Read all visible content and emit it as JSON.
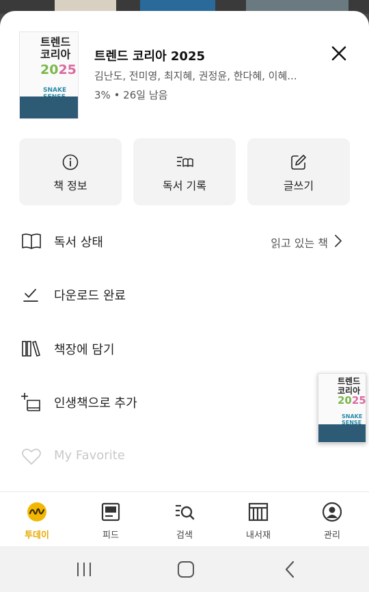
{
  "book": {
    "title": "트렌드 코리아 2025",
    "authors": "김난도, 전미영, 최지혜, 권정윤, 한다혜, 이혜...",
    "progress": "3% • 26일 남음",
    "cover": {
      "title_line1": "트렌드",
      "title_line2": "코리아",
      "year_a": "20",
      "year_b": "25",
      "snake_line1": "SNAKE",
      "snake_line2": "SENSE"
    }
  },
  "actions": [
    {
      "label": "책 정보",
      "icon": "info-icon"
    },
    {
      "label": "독서 기록",
      "icon": "reading-log-icon"
    },
    {
      "label": "글쓰기",
      "icon": "edit-icon"
    }
  ],
  "menu": {
    "reading_status": {
      "label": "독서 상태",
      "value": "읽고 있는 책"
    },
    "download": {
      "label": "다운로드 완료"
    },
    "bookshelf": {
      "label": "책장에 담기"
    },
    "life_book": {
      "label": "인생책으로 추가"
    },
    "favorite": {
      "label": "My Favorite"
    }
  },
  "tabs": [
    {
      "label": "투데이",
      "icon": "today-icon",
      "active": true
    },
    {
      "label": "피드",
      "icon": "feed-icon"
    },
    {
      "label": "검색",
      "icon": "search-icon"
    },
    {
      "label": "내서재",
      "icon": "library-icon"
    },
    {
      "label": "관리",
      "icon": "profile-icon"
    }
  ],
  "colors": {
    "accent": "#f2b705",
    "sheet_bg": "#ffffff",
    "action_bg": "#f3f3f3"
  }
}
